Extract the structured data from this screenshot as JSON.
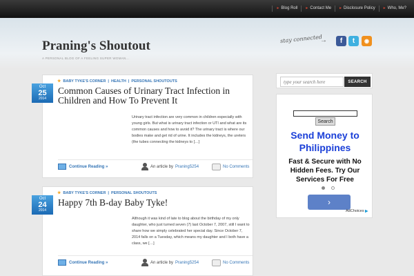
{
  "topnav": [
    "Blog Roll",
    "Contact Me",
    "Disclosure Policy",
    "Who, Me?"
  ],
  "site": {
    "title": "Praning's Shoutout",
    "tagline": "A PERSONAL BLOG OF A FEELING SUPER WOMAN...",
    "stay_connected": "stay connected"
  },
  "posts": [
    {
      "categories": [
        "BABY TYKE'S CORNER",
        "HEALTH",
        "PERSONAL SHOUTOUTS"
      ],
      "date": {
        "month": "Oct",
        "day": "25",
        "year": "2014"
      },
      "title": "Common Causes of Urinary Tract Infection in Children and How To Prevent It",
      "excerpt": "Urinary tract infection are very common in children especially with young girls. But what is urinary tract infection or UTI and what are its common causes and how to avoid it? The urinary tract is where our bodies make and get rid of urine. It includes the kidneys,  the ureters (the tubes connecting the kidneys to […]",
      "continue": "Continue Reading »",
      "author_label": "An article by",
      "author": "Praning5254",
      "comments": "No Comments"
    },
    {
      "categories": [
        "BABY TYKE'S CORNER",
        "PERSONAL SHOUTOUTS"
      ],
      "date": {
        "month": "Oct",
        "day": "24",
        "year": "2014"
      },
      "title": "Happy 7th B-day Baby Tyke!",
      "excerpt": "Although it was kind of late to blog about the birthday of my only daughter, who just turned seven (7) last October 7, 2007, still I want to share how we simply celebrated her special day. Since October 7, 2014 falls on a Tuesday, which means my daughter and I both have a class, we […]",
      "continue": "Continue Reading »",
      "author_label": "An article by",
      "author": "Praning5254",
      "comments": "No Comments"
    }
  ],
  "search": {
    "placeholder": "type your search here",
    "button": "SEARCH"
  },
  "ad": {
    "search_button": "Search",
    "title": "Send Money to Philippines",
    "body": "Fast & Secure with No Hidden Fees. Try Our Services For Free",
    "go": "›",
    "adchoices": "AdChoices"
  },
  "colors": {
    "link": "#3575b6",
    "date_box": "#1b6ab4",
    "ad_title": "#1a3fd8"
  }
}
